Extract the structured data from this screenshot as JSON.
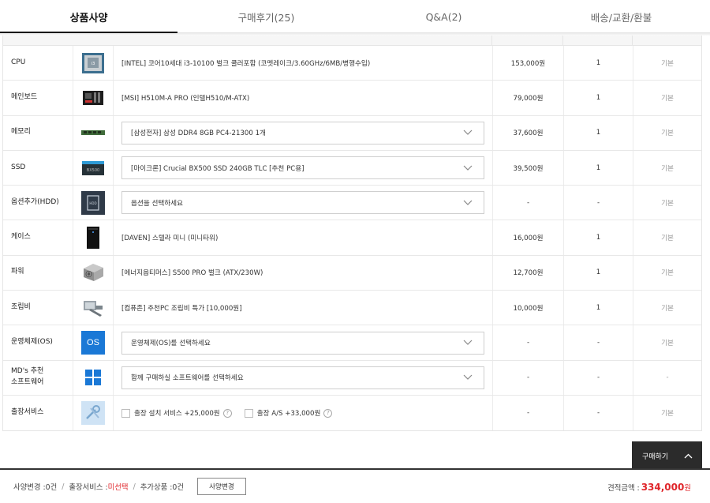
{
  "tabs": [
    {
      "label": "상품사양",
      "active": true
    },
    {
      "label": "구매후기(25)",
      "active": false
    },
    {
      "label": "Q&A(2)",
      "active": false
    },
    {
      "label": "배송/교환/환불",
      "active": false
    }
  ],
  "rows": [
    {
      "category": "CPU",
      "icon": "cpu-chip-icon",
      "type": "text",
      "name": "[INTEL] 코어10세대 i3-10100 벌크 쿨러포함 (코멧레이크/3.60GHz/6MB/병행수입)",
      "price": "153,000원",
      "qty": "1",
      "base": "기본"
    },
    {
      "category": "메인보드",
      "icon": "motherboard-icon",
      "type": "text",
      "name": "[MSI] H510M-A PRO (인텔H510/M-ATX)",
      "price": "79,000원",
      "qty": "1",
      "base": "기본"
    },
    {
      "category": "메모리",
      "icon": "ram-stick-icon",
      "type": "select",
      "name": "[삼성전자] 삼성 DDR4 8GB PC4-21300 1개",
      "price": "37,600원",
      "qty": "1",
      "base": "기본"
    },
    {
      "category": "SSD",
      "icon": "ssd-icon",
      "type": "select",
      "name": "[마이크론] Crucial BX500 SSD 240GB TLC [추천 PC용]",
      "price": "39,500원",
      "qty": "1",
      "base": "기본"
    },
    {
      "category": "옵션추가(HDD)",
      "icon": "hdd-icon",
      "type": "select",
      "name": "옵션을 선택하세요",
      "price": "-",
      "qty": "-",
      "base": "기본"
    },
    {
      "category": "케이스",
      "icon": "pc-case-icon",
      "type": "text",
      "name": "[DAVEN] 스텔라 미니 (미니타워)",
      "price": "16,000원",
      "qty": "1",
      "base": "기본"
    },
    {
      "category": "파워",
      "icon": "power-supply-icon",
      "type": "text",
      "name": "[에너지옵티머스] S500 PRO 벌크 (ATX/230W)",
      "price": "12,700원",
      "qty": "1",
      "base": "기본"
    },
    {
      "category": "조립비",
      "icon": "assembly-icon",
      "type": "text",
      "name": "[컴퓨존] 추천PC 조립비 특가 [10,000원]",
      "price": "10,000원",
      "qty": "1",
      "base": "기본"
    },
    {
      "category": "운영체제(OS)",
      "icon": "os-badge-icon",
      "icon_text": "OS",
      "type": "select",
      "name": "운영체제(OS)를 선택하세요",
      "price": "-",
      "qty": "-",
      "base": "기본"
    },
    {
      "category": "MD's 추천",
      "category2": "소프트웨어",
      "icon": "windows-logo-icon",
      "type": "select",
      "name": "함께 구매하실 소프트웨어를 선택하세요",
      "price": "-",
      "qty": "-",
      "base": "-"
    },
    {
      "category": "출장서비스",
      "icon": "service-tools-icon",
      "type": "service",
      "options": [
        "출장 설치 서비스 +25,000원",
        "출장 A/S +33,000원"
      ],
      "price": "-",
      "qty": "-",
      "base": "기본"
    }
  ],
  "buy_button": {
    "label": "구매하기",
    "icon": "chevron-up-icon"
  },
  "bottom_bar": {
    "spec_change_label": "사양변경 : ",
    "spec_change_value": "0건",
    "service_label": "출장서비스 : ",
    "service_value": "미선택",
    "extra_label": "추가상품 : ",
    "extra_value": "0건",
    "spec_button": "사양변경",
    "total_label": "견적금액 : ",
    "total_amount": "334,000",
    "total_unit": "원"
  },
  "colors": {
    "accent_red": "#e0262b",
    "dark_button": "#2b2b2b",
    "os_blue": "#1a78d6"
  }
}
